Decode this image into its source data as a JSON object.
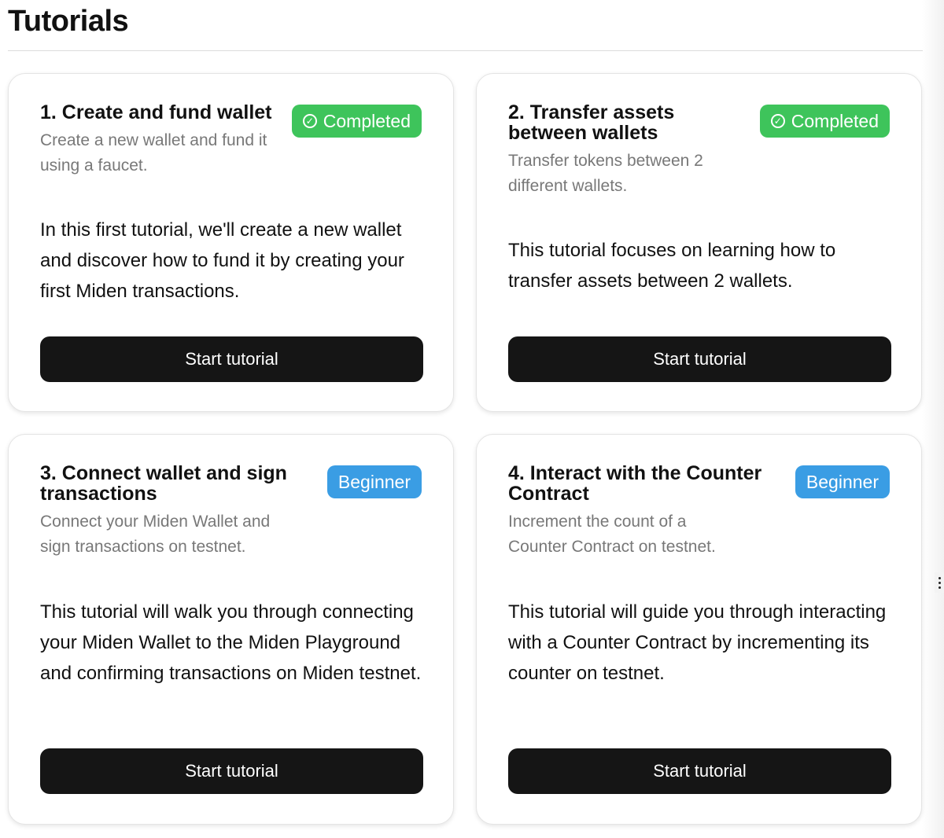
{
  "page": {
    "title": "Tutorials"
  },
  "colors": {
    "completed": "#3ec45b",
    "beginner": "#3a9de4",
    "button": "#151515"
  },
  "tutorials": [
    {
      "title": "1. Create and fund wallet",
      "subtitle": "Create a new wallet and fund it using a faucet.",
      "badge": "Completed",
      "badge_icon": "check-circle-icon",
      "description": "In this first tutorial, we'll create a new wallet and discover how to fund it by creating your first Miden transactions.",
      "button": "Start tutorial"
    },
    {
      "title": "2. Transfer assets between wallets",
      "subtitle": "Transfer tokens between 2 different wallets.",
      "badge": "Completed",
      "badge_icon": "check-circle-icon",
      "description": "This tutorial focuses on learning how to transfer assets between 2 wallets.",
      "button": "Start tutorial"
    },
    {
      "title": "3. Connect wallet and sign transactions",
      "subtitle": "Connect your Miden Wallet and sign transactions on testnet.",
      "badge": "Beginner",
      "description": "This tutorial will walk you through connecting your Miden Wallet to the Miden Playground and confirming transactions on Miden testnet.",
      "button": "Start tutorial"
    },
    {
      "title": "4. Interact with the Counter Contract",
      "subtitle": "Increment the count of a Counter Contract on testnet.",
      "badge": "Beginner",
      "description": "This tutorial will guide you through interacting with a Counter Contract by incrementing its counter on testnet.",
      "button": "Start tutorial"
    }
  ]
}
